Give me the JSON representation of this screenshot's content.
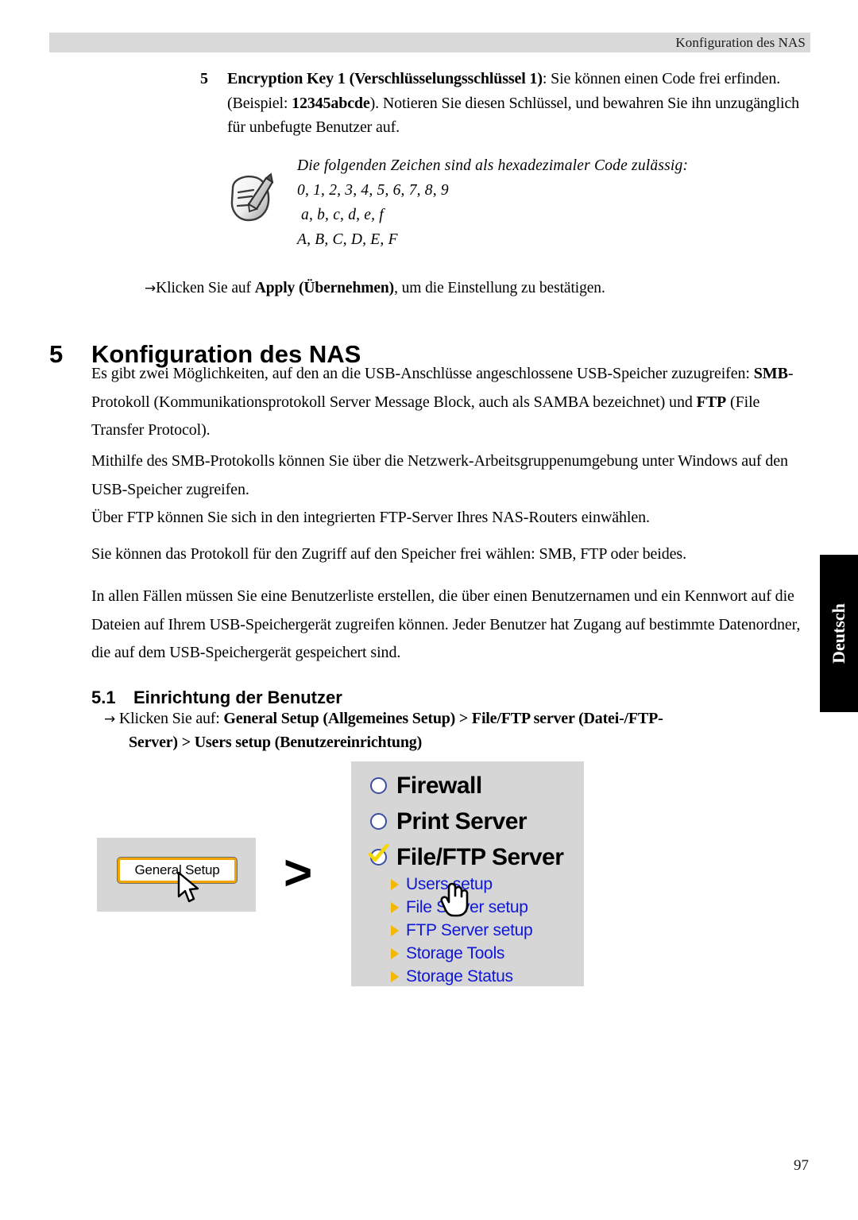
{
  "header": {
    "running_title": "Konfiguration des NAS"
  },
  "step": {
    "number": "5",
    "bold_lead": "Encryption Key 1 (Verschlüsselungsschlüssel 1)",
    "text_after_lead": ": Sie können einen Code frei erfinden. (Beispiel: ",
    "bold_example": "12345abcde",
    "text_tail": "). Notieren Sie diesen Schlüssel, und bewahren Sie ihn unzugänglich für unbefugte Benutzer auf."
  },
  "note": {
    "icon": "note-pencil-icon",
    "title": "Die folgenden Zeichen sind als hexadezimaler Code zulässig:",
    "digits": "0, 1, 2, 3, 4, 5, 6, 7, 8, 9",
    "lowercase": "a, b, c, d, e, f",
    "uppercase": "A, B, C, D, E, F"
  },
  "apply_instruction": {
    "arrow": "→",
    "prefix": "Klicken Sie auf ",
    "bold": "Apply (Übernehmen)",
    "suffix": ", um die Einstellung zu bestätigen."
  },
  "chapter": {
    "number": "5",
    "title": "Konfiguration des NAS"
  },
  "paragraphs": {
    "p1_a": "Es gibt zwei Möglichkeiten, auf den an die USB-Anschlüsse angeschlossene USB-Speicher zuzugreifen: ",
    "p1_b_smb": "SMB",
    "p1_c": "-Protokoll (Kommunikationsprotokoll Server Message Block, auch als SAMBA bezeichnet) und ",
    "p1_d_ftp": "FTP",
    "p1_e": " (File Transfer Protocol).",
    "p2_line1": "Mithilfe des SMB-Protokolls können Sie über die Netzwerk-Arbeitsgruppenumgebung unter Windows auf den USB-Speicher zugreifen.",
    "p2_line2": "Über FTP können Sie sich in den integrierten FTP-Server Ihres NAS-Routers einwählen.",
    "p3": "Sie können das Protokoll für den Zugriff auf den Speicher frei wählen: SMB, FTP oder beides.",
    "p4": "In allen Fällen müssen Sie eine Benutzerliste erstellen, die über einen Benutzernamen und ein Kennwort auf die Dateien auf Ihrem USB-Speichergerät zugreifen können. Jeder Benutzer hat Zugang auf bestimmte Datenordner, die auf dem USB-Speichergerät gespeichert sind."
  },
  "section": {
    "number": "5.1",
    "title": "Einrichtung der Benutzer",
    "steps_arrow": "→",
    "steps_prefix": "Klicken Sie auf: ",
    "steps_path_1": "General Setup (Allgemeines Setup) > File/FTP server (Datei-/FTP-",
    "steps_path_2": "Server) > Users setup (Benutzereinrichtung)"
  },
  "figure": {
    "general_setup_button": "General Setup",
    "separator_arrow": ">",
    "menu": [
      {
        "label": "Firewall",
        "state": "unchecked",
        "icon": "radio-unchecked-icon"
      },
      {
        "label": "Print Server",
        "state": "unchecked",
        "icon": "radio-unchecked-icon"
      },
      {
        "label": "File/FTP Server",
        "state": "checked",
        "icon": "radio-checked-icon"
      }
    ],
    "submenu": [
      {
        "label": "Users setup",
        "icon": "triangle-bullet-icon"
      },
      {
        "label": "File Server setup",
        "icon": "triangle-bullet-icon"
      },
      {
        "label": "FTP Server setup",
        "icon": "triangle-bullet-icon"
      },
      {
        "label": "Storage Tools",
        "icon": "triangle-bullet-icon"
      },
      {
        "label": "Storage Status",
        "icon": "triangle-bullet-icon"
      }
    ],
    "cursors": [
      {
        "type": "arrow-cursor-icon",
        "over": "general-setup-button"
      },
      {
        "type": "hand-cursor-icon",
        "over": "users-setup-link"
      }
    ],
    "colors": {
      "panel_background": "#d6d6d6",
      "link_blue": "#0f17d6",
      "bullet_yellow": "#f5b800",
      "button_border_orange": "#f0a500",
      "radio_border_blue": "#3b4fa0"
    }
  },
  "side_tab": {
    "label": "Deutsch",
    "background": "#000000",
    "text_color": "#ffffff"
  },
  "footer": {
    "page_number": "97"
  }
}
